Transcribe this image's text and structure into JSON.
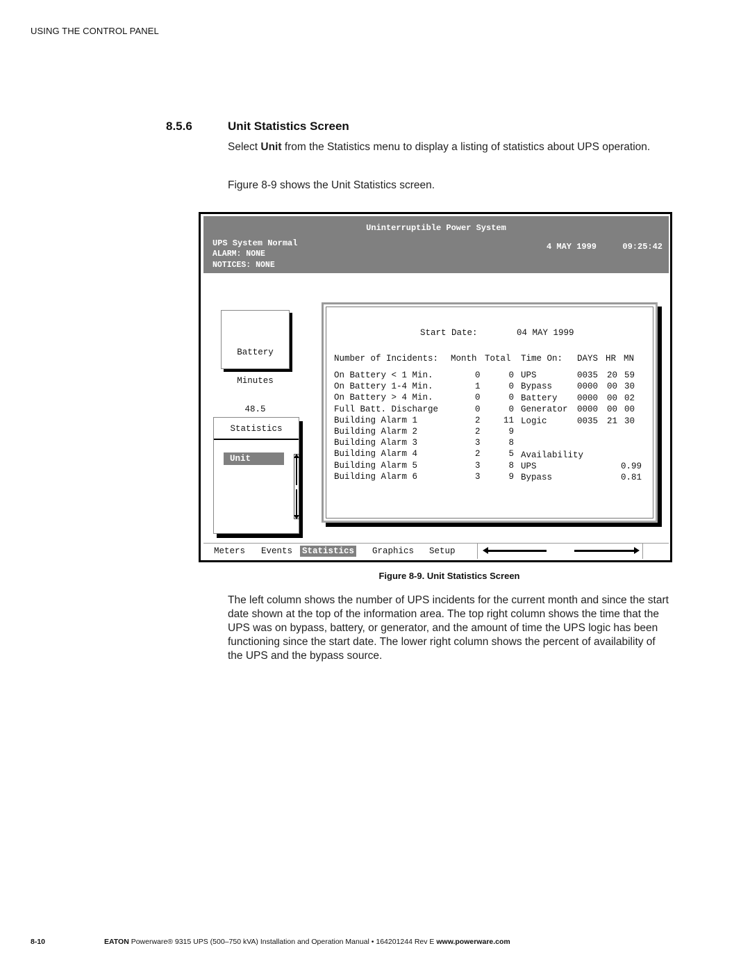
{
  "page": {
    "running_head": "USING THE CONTROL PANEL",
    "section_number": "8.5.6",
    "section_title": "Unit Statistics Screen",
    "intro_pre": "Select ",
    "intro_bold": "Unit",
    "intro_post": " from the Statistics menu to display a listing of statistics about UPS operation.",
    "figure_ref_text": "Figure 8-9 shows the Unit Statistics screen.",
    "figure_caption": "Figure 8-9. Unit Statistics Screen",
    "explanation": "The left column shows the number of UPS incidents for the current month and since the start date shown at the top of the information area. The top right column shows the time that the UPS was on bypass, battery, or generator, and the amount of time the UPS logic has been functioning since the start date. The lower right column shows the percent of availability of the UPS and the bypass source.",
    "footer_page": "8-10",
    "footer_brand": "EATON",
    "footer_text": " Powerware® 9315 UPS (500–750 kVA) Installation and Operation Manual  •  164201244 Rev E ",
    "footer_url": "www.powerware.com"
  },
  "screen": {
    "header": {
      "title": "Uninterruptible Power System",
      "status": "UPS System Normal",
      "alarm": "ALARM:  NONE",
      "notices": "NOTICES: NONE",
      "date": "4 MAY 1999",
      "time": "09:25:42"
    },
    "battery": {
      "label1": "Battery",
      "label2": "Minutes",
      "value": "48.5"
    },
    "stats_menu": {
      "title": "Statistics",
      "items": [
        {
          "label": "Unit",
          "selected": true
        }
      ]
    },
    "info": {
      "start_date_label": "Start Date:",
      "start_date_value": "04 MAY 1999",
      "incidents_header": "Number of Incidents:",
      "month_header": "Month",
      "total_header": "Total",
      "time_on_header": "Time On:",
      "days_header": "DAYS",
      "hr_header": "HR",
      "mn_header": "MN",
      "incidents": [
        {
          "label": "On Battery < 1 Min.",
          "month": "0",
          "total": "0"
        },
        {
          "label": "On Battery 1-4 Min.",
          "month": "1",
          "total": "0"
        },
        {
          "label": "On Battery > 4 Min.",
          "month": "0",
          "total": "0"
        },
        {
          "label": "Full Batt. Discharge",
          "month": "0",
          "total": "0"
        },
        {
          "label": "Building Alarm 1",
          "month": "2",
          "total": "11"
        },
        {
          "label": "Building Alarm 2",
          "month": "2",
          "total": "9"
        },
        {
          "label": "Building Alarm 3",
          "month": "3",
          "total": "8"
        },
        {
          "label": "Building Alarm 4",
          "month": "2",
          "total": "5"
        },
        {
          "label": "Building Alarm 5",
          "month": "3",
          "total": "8"
        },
        {
          "label": "Building Alarm 6",
          "month": "3",
          "total": "9"
        }
      ],
      "time_on": [
        {
          "label": "UPS",
          "days": "0035",
          "hr": "20",
          "mn": "59"
        },
        {
          "label": "Bypass",
          "days": "0000",
          "hr": "00",
          "mn": "30"
        },
        {
          "label": "Battery",
          "days": "0000",
          "hr": "00",
          "mn": "02"
        },
        {
          "label": "Generator",
          "days": "0000",
          "hr": "00",
          "mn": "00"
        },
        {
          "label": "Logic",
          "days": "0035",
          "hr": "21",
          "mn": "30"
        }
      ],
      "availability_header": "Availability",
      "availability": [
        {
          "label": "UPS",
          "value": "0.99"
        },
        {
          "label": "Bypass",
          "value": "0.81"
        }
      ]
    },
    "tabs": [
      {
        "label": "Meters",
        "active": false
      },
      {
        "label": "Events",
        "active": false
      },
      {
        "label": "Statistics",
        "active": true
      },
      {
        "label": "Graphics",
        "active": false
      },
      {
        "label": "Setup",
        "active": false
      }
    ],
    "nav_icons": {
      "left": "arrow-left-icon",
      "right": "arrow-right-icon"
    }
  }
}
